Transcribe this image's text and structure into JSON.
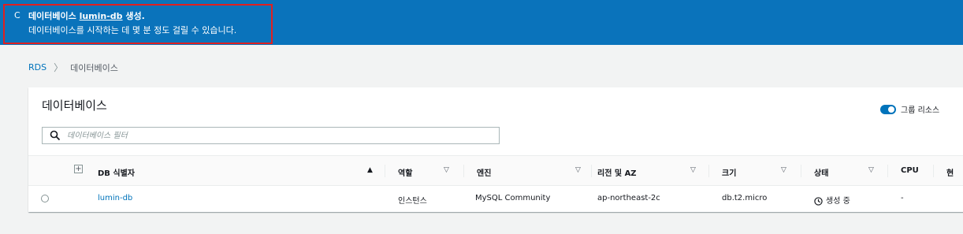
{
  "banner": {
    "spinner": "C",
    "prefix": "데이터베이스",
    "db_name": "lumin-db",
    "suffix": "생성.",
    "message": "데이터베이스를 시작하는 데 몇 분 정도 걸릴 수 있습니다."
  },
  "breadcrumb": {
    "root": "RDS",
    "separator": "〉",
    "current": "데이터베이스"
  },
  "panel": {
    "title": "데이터베이스",
    "group_toggle_label": "그룹 리소스",
    "filter_placeholder": "데이터베이스 필터"
  },
  "table": {
    "columns": {
      "db_id": "DB 식별자",
      "role": "역할",
      "engine": "엔진",
      "region": "리전 및 AZ",
      "size": "크기",
      "status": "상태",
      "cpu": "CPU",
      "extra": "현"
    },
    "sort_asc": "▲",
    "sort_filter": "▽",
    "rows": [
      {
        "db_id": "lumin-db",
        "role": "인스턴스",
        "engine": "MySQL Community",
        "region": "ap-northeast-2c",
        "size": "db.t2.micro",
        "status": "생성 중",
        "cpu": "-"
      }
    ]
  },
  "colors": {
    "banner_bg": "#0a73bb",
    "link": "#0073bb",
    "highlight": "#e02020"
  },
  "icons": [
    "spinner-icon",
    "chevron-right-icon",
    "search-icon",
    "toggle-icon",
    "expand-icon",
    "sort-icon",
    "radio-icon",
    "clock-icon"
  ]
}
